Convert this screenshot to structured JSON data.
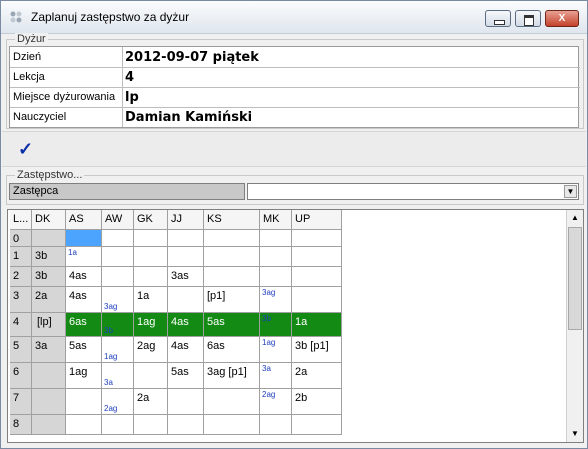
{
  "window": {
    "title": "Zaplanuj zastępstwo za dyżur",
    "min_label": "",
    "max_label": "",
    "close_label": "X"
  },
  "dyzur": {
    "group_label": "Dyżur",
    "rows": [
      {
        "label": "Dzień",
        "value": "2012-09-07 piątek"
      },
      {
        "label": "Lekcja",
        "value": "4"
      },
      {
        "label": "Miejsce dyżurowania",
        "value": "lp"
      },
      {
        "label": "Nauczyciel",
        "value": "Damian Kamiński"
      }
    ]
  },
  "toolbar": {
    "confirm_icon": "checkmark-icon",
    "confirm_glyph": "✓"
  },
  "zastepstwo": {
    "group_label": "Zastępstwo...",
    "field_label": "Zastępca",
    "field_value": "",
    "dropdown_glyph": "▼"
  },
  "grid": {
    "columns": [
      "L...",
      "DK",
      "AS",
      "AW",
      "GK",
      "JJ",
      "KS",
      "MK",
      "UP"
    ],
    "rows": [
      {
        "cells": [
          {
            "t": "0"
          },
          {
            "t": ""
          },
          {
            "t": "",
            "sel": true
          },
          {
            "t": ""
          },
          {
            "t": ""
          },
          {
            "t": ""
          },
          {
            "t": ""
          },
          {
            "t": ""
          },
          {
            "t": ""
          }
        ]
      },
      {
        "cells": [
          {
            "t": "1"
          },
          {
            "t": "3b"
          },
          {
            "t": "",
            "sm": "1a",
            "smpos": "top"
          },
          {
            "t": ""
          },
          {
            "t": ""
          },
          {
            "t": ""
          },
          {
            "t": ""
          },
          {
            "t": ""
          },
          {
            "t": ""
          }
        ]
      },
      {
        "cells": [
          {
            "t": "2"
          },
          {
            "t": "3b"
          },
          {
            "t": "4as"
          },
          {
            "t": ""
          },
          {
            "t": ""
          },
          {
            "t": "3as"
          },
          {
            "t": ""
          },
          {
            "t": ""
          },
          {
            "t": ""
          }
        ]
      },
      {
        "cells": [
          {
            "t": "3"
          },
          {
            "t": "2a"
          },
          {
            "t": "4as"
          },
          {
            "t": "",
            "sm": "3ag",
            "smpos": "bottom"
          },
          {
            "t": "1a"
          },
          {
            "t": ""
          },
          {
            "t": "[p1]"
          },
          {
            "t": "",
            "sm": "3ag",
            "smpos": "top"
          },
          {
            "t": ""
          }
        ]
      },
      {
        "green": true,
        "cells": [
          {
            "t": "4"
          },
          {
            "t": "[lp]"
          },
          {
            "t": "6as"
          },
          {
            "t": "",
            "sm": "3b",
            "smpos": "bottom"
          },
          {
            "t": "1ag"
          },
          {
            "t": "4as"
          },
          {
            "t": "5as"
          },
          {
            "t": "",
            "sm": "3b",
            "smpos": "top"
          },
          {
            "t": "1a"
          }
        ]
      },
      {
        "cells": [
          {
            "t": "5"
          },
          {
            "t": "3a"
          },
          {
            "t": "5as"
          },
          {
            "t": "",
            "sm": "1ag",
            "smpos": "bottom"
          },
          {
            "t": "2ag"
          },
          {
            "t": "4as"
          },
          {
            "t": "6as"
          },
          {
            "t": "",
            "sm": "1ag",
            "smpos": "top"
          },
          {
            "t": "3b [p1]"
          }
        ]
      },
      {
        "cells": [
          {
            "t": "6"
          },
          {
            "t": ""
          },
          {
            "t": "1ag"
          },
          {
            "t": "",
            "sm": "3a",
            "smpos": "bottom"
          },
          {
            "t": ""
          },
          {
            "t": "5as"
          },
          {
            "t": "3ag [p1]"
          },
          {
            "t": "",
            "sm": "3a",
            "smpos": "top"
          },
          {
            "t": "2a"
          }
        ]
      },
      {
        "cells": [
          {
            "t": "7"
          },
          {
            "t": ""
          },
          {
            "t": ""
          },
          {
            "t": "",
            "sm": "2ag",
            "smpos": "bottom"
          },
          {
            "t": "2a"
          },
          {
            "t": ""
          },
          {
            "t": ""
          },
          {
            "t": "",
            "sm": "2ag",
            "smpos": "top"
          },
          {
            "t": "2b"
          }
        ]
      },
      {
        "cells": [
          {
            "t": "8"
          },
          {
            "t": ""
          },
          {
            "t": ""
          },
          {
            "t": ""
          },
          {
            "t": ""
          },
          {
            "t": ""
          },
          {
            "t": ""
          },
          {
            "t": ""
          },
          {
            "t": ""
          }
        ]
      }
    ]
  },
  "scrollbar": {
    "up_glyph": "▲",
    "down_glyph": "▼"
  }
}
